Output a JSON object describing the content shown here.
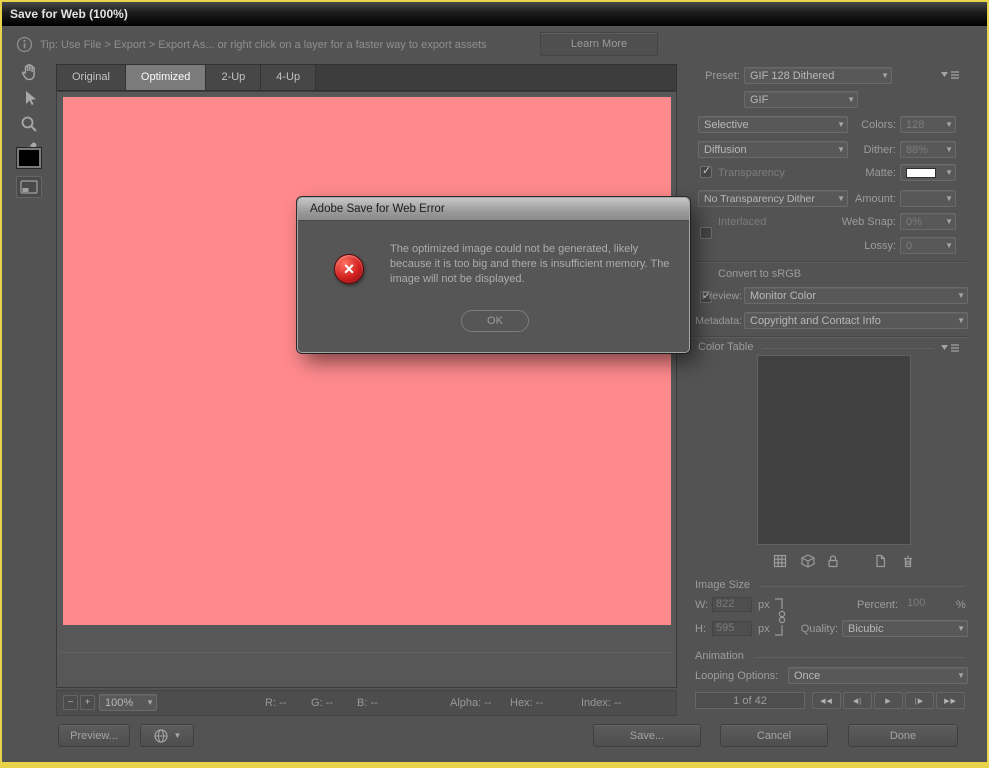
{
  "window": {
    "title": "Save for Web (100%)"
  },
  "tipbar": {
    "text": "Tip: Use File > Export > Export As...  or right click on a layer for a faster way to export assets",
    "learn_more": "Learn More"
  },
  "tabs": [
    {
      "label": "Original"
    },
    {
      "label": "Optimized"
    },
    {
      "label": "2-Up"
    },
    {
      "label": "4-Up"
    }
  ],
  "error_dialog": {
    "title": "Adobe Save for Web Error",
    "message": "The optimized image could not be generated, likely because it is too big and there is insufficient memory. The image will not be displayed.",
    "ok_label": "OK"
  },
  "settings": {
    "preset_label": "Preset:",
    "preset_value": "GIF 128 Dithered",
    "format_value": "GIF",
    "reduction_value": "Selective",
    "colors_label": "Colors:",
    "colors_value": "128",
    "dither_method_value": "Diffusion",
    "dither_label": "Dither:",
    "dither_value": "88%",
    "transparency_label": "Transparency",
    "transparency_checked": true,
    "matte_label": "Matte:",
    "transparency_dither_value": "No Transparency Dither",
    "amount_label": "Amount:",
    "interlaced_label": "Interlaced",
    "interlaced_checked": false,
    "web_snap_label": "Web Snap:",
    "web_snap_value": "0%",
    "lossy_label": "Lossy:",
    "lossy_value": "0",
    "convert_srgb_label": "Convert to sRGB",
    "convert_srgb_checked": true,
    "preview_label": "Preview:",
    "preview_value": "Monitor Color",
    "metadata_label": "Metadata:",
    "metadata_value": "Copyright and Contact Info"
  },
  "color_table": {
    "title": "Color Table"
  },
  "image_size": {
    "title": "Image Size",
    "w_label": "W:",
    "w_value": "822",
    "w_unit": "px",
    "h_label": "H:",
    "h_value": "595",
    "h_unit": "px",
    "percent_label": "Percent:",
    "percent_value": "100",
    "percent_unit": "%",
    "quality_label": "Quality:",
    "quality_value": "Bicubic"
  },
  "animation": {
    "title": "Animation",
    "looping_label": "Looping Options:",
    "looping_value": "Once",
    "frame_counter": "1 of 42",
    "nav": {
      "first": "◀◀",
      "prev": "◀|",
      "play": "▶",
      "next": "|▶",
      "last": "▶▶"
    }
  },
  "statusbar": {
    "zoom_value": "100%",
    "minus": "−",
    "plus": "+",
    "r": "R: --",
    "g": "G: --",
    "b": "B: --",
    "alpha": "Alpha: --",
    "hex": "Hex: --",
    "index": "Index: --"
  },
  "footer": {
    "preview_label": "Preview...",
    "save_label": "Save...",
    "cancel_label": "Cancel",
    "done_label": "Done"
  },
  "colors": {
    "image_fill": "#ff8a8d",
    "matte_swatch": "#ffffff",
    "accent_border": "#e7d44b"
  }
}
